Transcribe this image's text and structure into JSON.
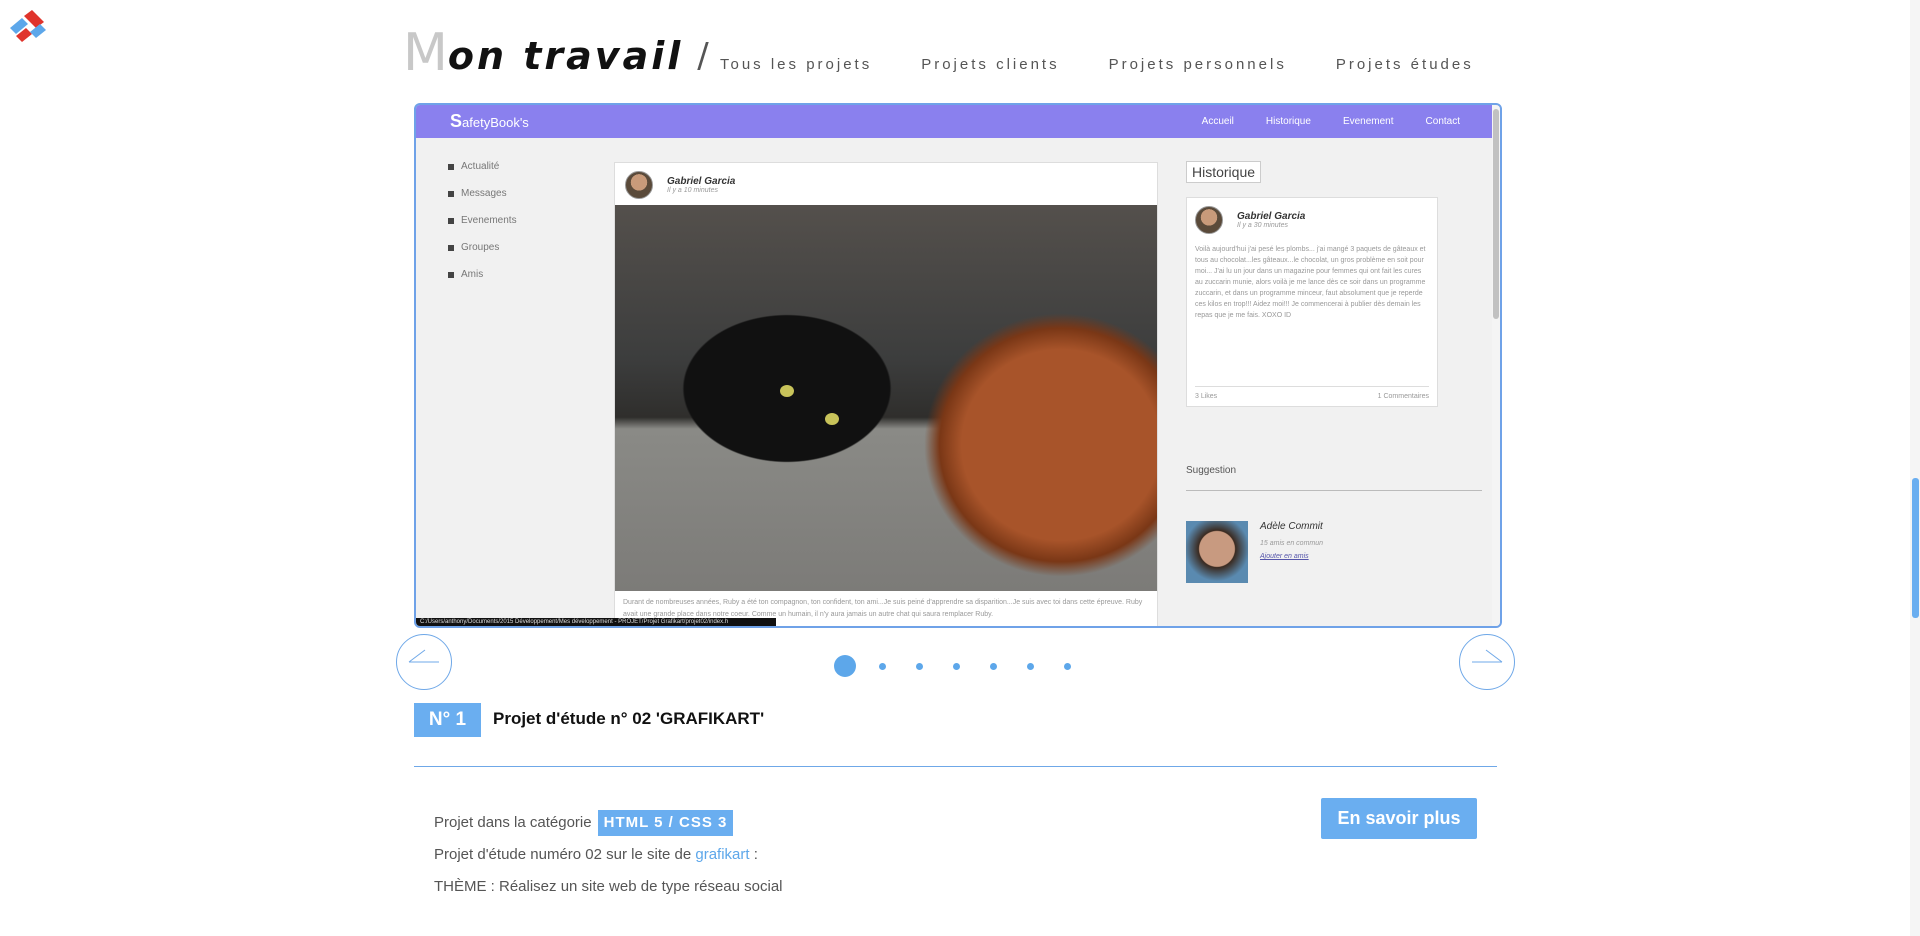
{
  "header": {
    "title_first_letter": "M",
    "title_rest": "on travail",
    "title_slash": "/",
    "nav": [
      "Tous les projets",
      "Projets clients",
      "Projets personnels",
      "Projets études"
    ]
  },
  "preview": {
    "brand_letter": "S",
    "brand_rest": "afetyBook's",
    "nav": [
      "Accueil",
      "Historique",
      "Evenement",
      "Contact"
    ],
    "sidebar": [
      "Actualité",
      "Messages",
      "Evenements",
      "Groupes",
      "Amis"
    ],
    "post": {
      "author": "Gabriel Garcia",
      "time": "Il y a 10 minutes",
      "caption": "Durant de nombreuses années, Ruby a été ton compagnon, ton confident, ton ami...Je suis peiné d'apprendre sa disparition...Je suis avec toi dans cette épreuve. Ruby avait une grande place dans notre coeur. Comme un humain, il n'y aura jamais un autre chat qui saura remplacer Ruby."
    },
    "history": {
      "button": "Historique",
      "author": "Gabriel Garcia",
      "time": "Il y a 30 minutes",
      "text": "Voilà aujourd'hui j'ai pesé les plombs... j'ai mangé 3 paquets de gâteaux et tous au chocolat...les gâteaux...le chocolat, un gros problème en soit pour moi... J'ai lu un jour dans un magazine pour femmes qui ont fait les cures au zuccarin munie, alors voilà je me lance dès ce soir dans un programme zuccarin, et dans un programme minceur, faut absolument que je reperde ces kilos en trop!!! Aidez moi!!! Je commencerai à publier dès demain les repas que je me fais. XOXO ID",
      "likes": "3 Likes",
      "comments": "1 Commentaires"
    },
    "suggestion": {
      "title": "Suggestion",
      "name": "Adèle Commit",
      "common": "15 amis en commun",
      "add": "Ajouter en amis"
    },
    "status_url": "C:/Users/anthony/Documents/2015 Développement/Mes développement - PROJET/Projet Grafikart/projet02/index.h"
  },
  "carousel": {
    "dots": 7,
    "active_index": 0
  },
  "project": {
    "badge": "N° 1",
    "title": "Projet d'étude n° 02 'GRAFIKART'",
    "category_prefix": "Projet dans la catégorie",
    "category": "HTML 5 / CSS 3",
    "desc_prefix": "Projet d'étude numéro 02 sur le site de",
    "desc_link": "grafikart",
    "desc_suffix": ":",
    "theme": "THÈME : Réalisez un site web de type réseau social",
    "more_button": "En savoir plus"
  },
  "colors": {
    "accent": "#6aaef0",
    "preview_header": "#8a80ee"
  }
}
